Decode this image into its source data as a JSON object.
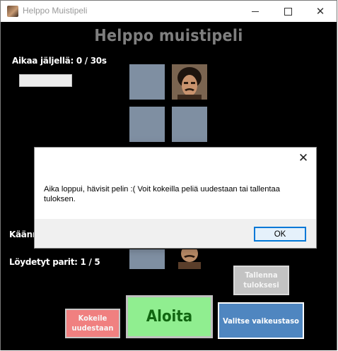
{
  "window": {
    "title": "Helppo Muistipeli",
    "icon": "app-portrait-icon",
    "controls": {
      "minimize": "minimize-icon",
      "maximize": "maximize-icon",
      "close": "close-icon"
    }
  },
  "game": {
    "title": "Helppo muistipeli",
    "time_label": "Aikaa jäljellä: 0 / 30s",
    "time_progress": 0,
    "turns_label": "Käänn",
    "pairs_label": "Löydetyt parit: 1 / 5",
    "cards": [
      {
        "state": "hidden"
      },
      {
        "state": "face-up",
        "image": "portrait-mustache-man"
      },
      {
        "state": "hidden"
      },
      {
        "state": "hidden"
      },
      {
        "state": "hidden"
      },
      {
        "state": "face-up",
        "image": "portrait-mustache-man"
      }
    ]
  },
  "buttons": {
    "save": "Tallenna tuloksesi",
    "retry": "Kokeile uudestaan",
    "start": "Aloita",
    "difficulty": "Valitse vaikeustaso"
  },
  "dialog": {
    "message": "Aika loppui, hävisit pelin :(  Voit kokeilla peliä uudestaan tai tallentaa tuloksen.",
    "ok_label": "OK",
    "close_icon": "close-icon"
  },
  "colors": {
    "card_back": "#7f8fa2",
    "title_gray": "#7f7f7f",
    "start_green": "#90ee90",
    "retry_red": "#f08080",
    "difficulty_blue": "#4f86c0",
    "save_gray": "#c3c3c3",
    "dialog_ok_border": "#0078d7"
  }
}
